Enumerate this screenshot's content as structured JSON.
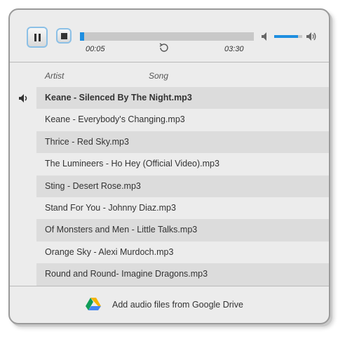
{
  "player": {
    "current_time": "00:05",
    "total_time": "03:30",
    "progress_fraction": 0.02,
    "volume_fraction": 0.85,
    "accent_color": "#1e8ee0"
  },
  "columns": {
    "artist": "Artist",
    "song": "Song"
  },
  "tracks": [
    {
      "label": "Keane - Silenced By The Night.mp3",
      "playing": true
    },
    {
      "label": "Keane - Everybody's Changing.mp3",
      "playing": false
    },
    {
      "label": "Thrice - Red Sky.mp3",
      "playing": false
    },
    {
      "label": "The Lumineers - Ho Hey (Official Video).mp3",
      "playing": false
    },
    {
      "label": "Sting - Desert Rose.mp3",
      "playing": false
    },
    {
      "label": "Stand For You - Johnny Diaz.mp3",
      "playing": false
    },
    {
      "label": "Of Monsters and Men - Little Talks.mp3",
      "playing": false
    },
    {
      "label": "Orange Sky - Alexi Murdoch.mp3",
      "playing": false
    },
    {
      "label": "Round and Round- Imagine Dragons.mp3",
      "playing": false
    }
  ],
  "footer": {
    "add_label": "Add audio files from Google Drive"
  }
}
